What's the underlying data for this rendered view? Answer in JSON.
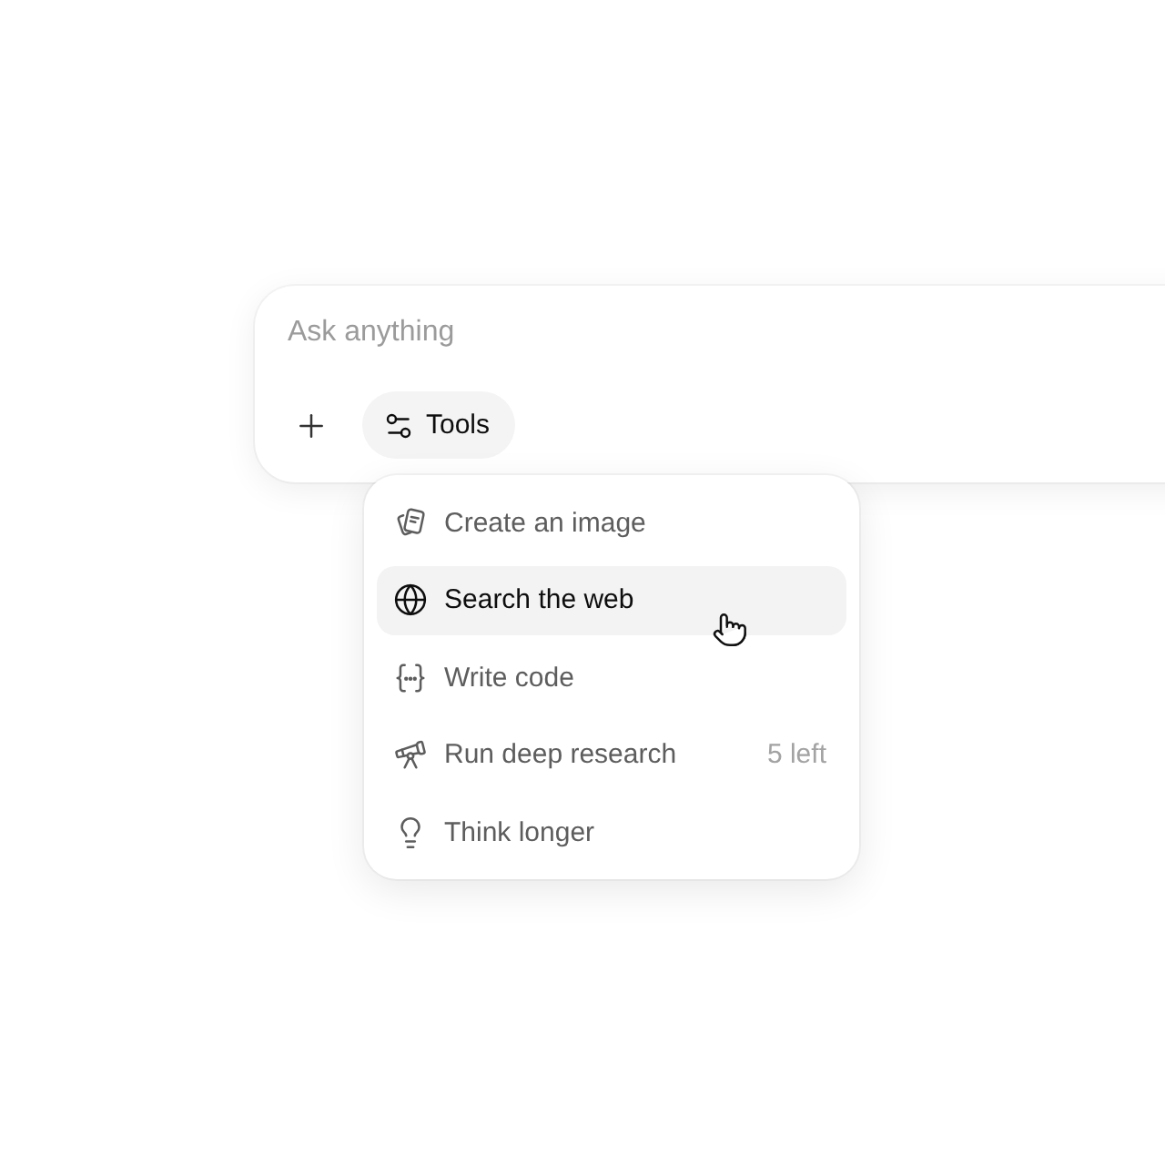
{
  "composer": {
    "placeholder": "Ask anything",
    "tools_button": {
      "label": "Tools",
      "expanded": true
    }
  },
  "tools_menu": {
    "items": [
      {
        "label": "Create an image",
        "selected": false
      },
      {
        "label": "Search the web",
        "selected": true
      },
      {
        "label": "Write code",
        "selected": false
      },
      {
        "label": "Run deep research",
        "selected": false,
        "badge": "5 left"
      },
      {
        "label": "Think longer",
        "selected": false
      }
    ]
  }
}
